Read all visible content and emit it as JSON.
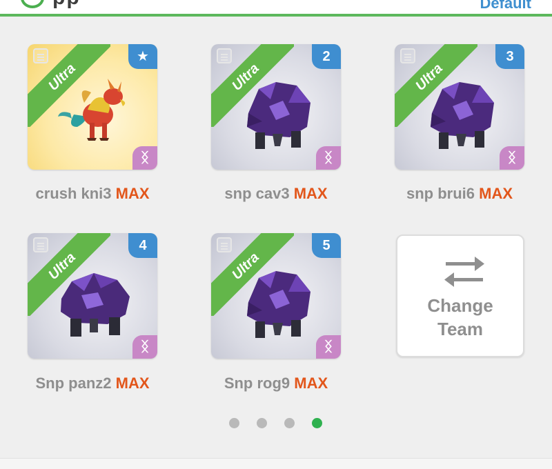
{
  "header": {
    "title_fragment": "pp",
    "team_name": "Default"
  },
  "cards": [
    {
      "rarity": "Ultra",
      "slot_badge": "★",
      "element_symbol": "ᛝ",
      "name": "crush kni3",
      "level": "MAX",
      "creature": "dragon-icon"
    },
    {
      "rarity": "Ultra",
      "slot_badge": "2",
      "element_symbol": "ᛝ",
      "name": "snp cav3",
      "level": "MAX",
      "creature": "rock-beast-icon"
    },
    {
      "rarity": "Ultra",
      "slot_badge": "3",
      "element_symbol": "ᛝ",
      "name": "snp brui6",
      "level": "MAX",
      "creature": "rock-beast-icon"
    },
    {
      "rarity": "Ultra",
      "slot_badge": "4",
      "element_symbol": "ᛝ",
      "name": "Snp panz2",
      "level": "MAX",
      "creature": "rock-beast-icon"
    },
    {
      "rarity": "Ultra",
      "slot_badge": "5",
      "element_symbol": "ᛝ",
      "name": "Snp rog9",
      "level": "MAX",
      "creature": "rock-beast-icon"
    }
  ],
  "change_team": {
    "line1": "Change",
    "line2": "Team"
  },
  "pager": {
    "count": 4,
    "active_index": 3
  },
  "colors": {
    "ultra_ribbon": "#63b64a",
    "slot_badge": "#3f8ed0",
    "element_badge": "#c887c6",
    "level_max": "#e2561b",
    "active_dot": "#2fb14f"
  }
}
